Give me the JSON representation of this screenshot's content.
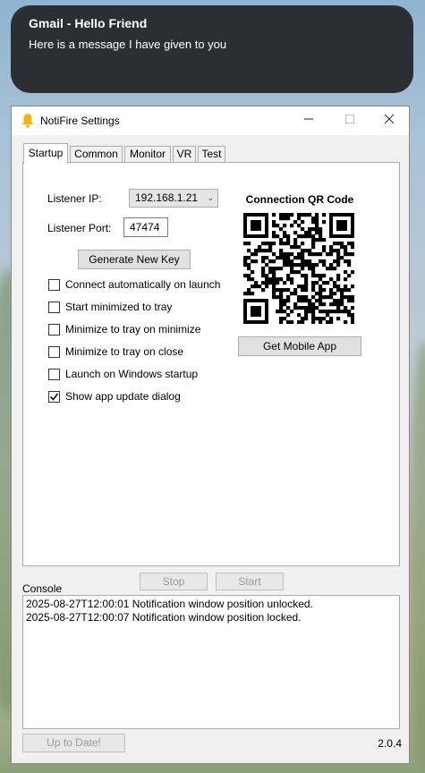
{
  "notification": {
    "title": "Gmail - Hello Friend",
    "message": "Here is a message I have given to you"
  },
  "window": {
    "title": "NotiFire Settings",
    "icon": "bell-icon",
    "controls": {
      "minimize": "—",
      "maximize": "☐",
      "close": "✕"
    }
  },
  "tabs": [
    {
      "label": "Startup",
      "active": true
    },
    {
      "label": "Common",
      "active": false
    },
    {
      "label": "Monitor",
      "active": false
    },
    {
      "label": "VR",
      "active": false
    },
    {
      "label": "Test",
      "active": false
    }
  ],
  "startup": {
    "listener_ip_label": "Listener IP:",
    "listener_ip_value": "192.168.1.21",
    "listener_port_label": "Listener Port:",
    "listener_port_value": "47474",
    "generate_key_label": "Generate New Key",
    "checkboxes": [
      {
        "label": "Connect automatically on launch",
        "checked": false
      },
      {
        "label": "Start minimized to tray",
        "checked": false
      },
      {
        "label": "Minimize to tray on minimize",
        "checked": false
      },
      {
        "label": "Minimize to tray on close",
        "checked": false
      },
      {
        "label": "Launch on Windows startup",
        "checked": false
      },
      {
        "label": "Show app update dialog",
        "checked": true
      }
    ],
    "qr_title": "Connection QR Code",
    "get_mobile_app_label": "Get Mobile App"
  },
  "controls": {
    "stop_label": "Stop",
    "start_label": "Start"
  },
  "console": {
    "label": "Console",
    "lines": [
      "2025-08-27T12:00:01 Notification window position unlocked.",
      "2025-08-27T12:00:07 Notification window position locked."
    ]
  },
  "footer": {
    "update_label": "Up to Date!",
    "version": "2.0.4"
  },
  "colors": {
    "toast_bg": "#2b2f33",
    "bell": "#f2b50c",
    "window_bg": "#f0f0f0"
  }
}
